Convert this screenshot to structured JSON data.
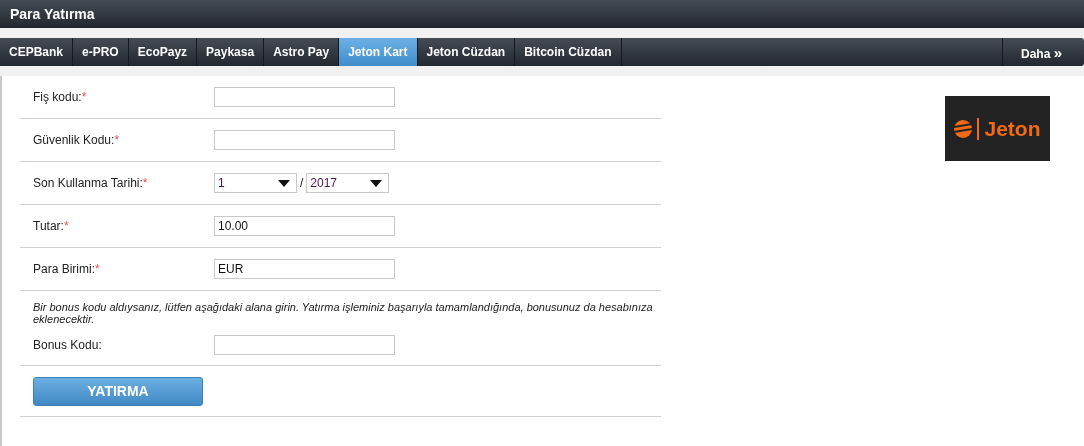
{
  "header": {
    "title": "Para Yatırma"
  },
  "tabs": [
    {
      "label": "CEPBank",
      "selected": false
    },
    {
      "label": "e-PRO",
      "selected": false
    },
    {
      "label": "EcoPayz",
      "selected": false
    },
    {
      "label": "Paykasa",
      "selected": false
    },
    {
      "label": "Astro Pay",
      "selected": false
    },
    {
      "label": "Jeton Kart",
      "selected": true
    },
    {
      "label": "Jeton Cüzdan",
      "selected": false
    },
    {
      "label": "Bitcoin Cüzdan",
      "selected": false
    }
  ],
  "more": {
    "label": "Daha",
    "icon": "»"
  },
  "form": {
    "rows": [
      {
        "kind": "text",
        "label": "Fiş kodu:",
        "mark": "*"
      },
      {
        "kind": "text",
        "label": "Güvenlik Kodu:",
        "mark": "*"
      },
      {
        "kind": "date",
        "label": "Son Kullanma Tarihi:",
        "mark": "*",
        "month": "1",
        "separator": "/",
        "year": "2017"
      },
      {
        "kind": "text",
        "label": "Tutar:",
        "mark": "*",
        "value": "10.00"
      },
      {
        "kind": "text",
        "label": "Para Birimi:",
        "mark": "*",
        "value": "EUR"
      }
    ],
    "bonus_note": "Bir bonus kodu aldıysanız, lütfen aşağıdaki alana girin. Yatırma işleminiz başarıyla tamamlandığında, bonusunuz da hesabınıza eklenecektir.",
    "bonus": {
      "kind": "text",
      "label": "Bonus Kodu:"
    },
    "submit": "YATIRMA"
  },
  "logo": {
    "text": "Jeton"
  }
}
